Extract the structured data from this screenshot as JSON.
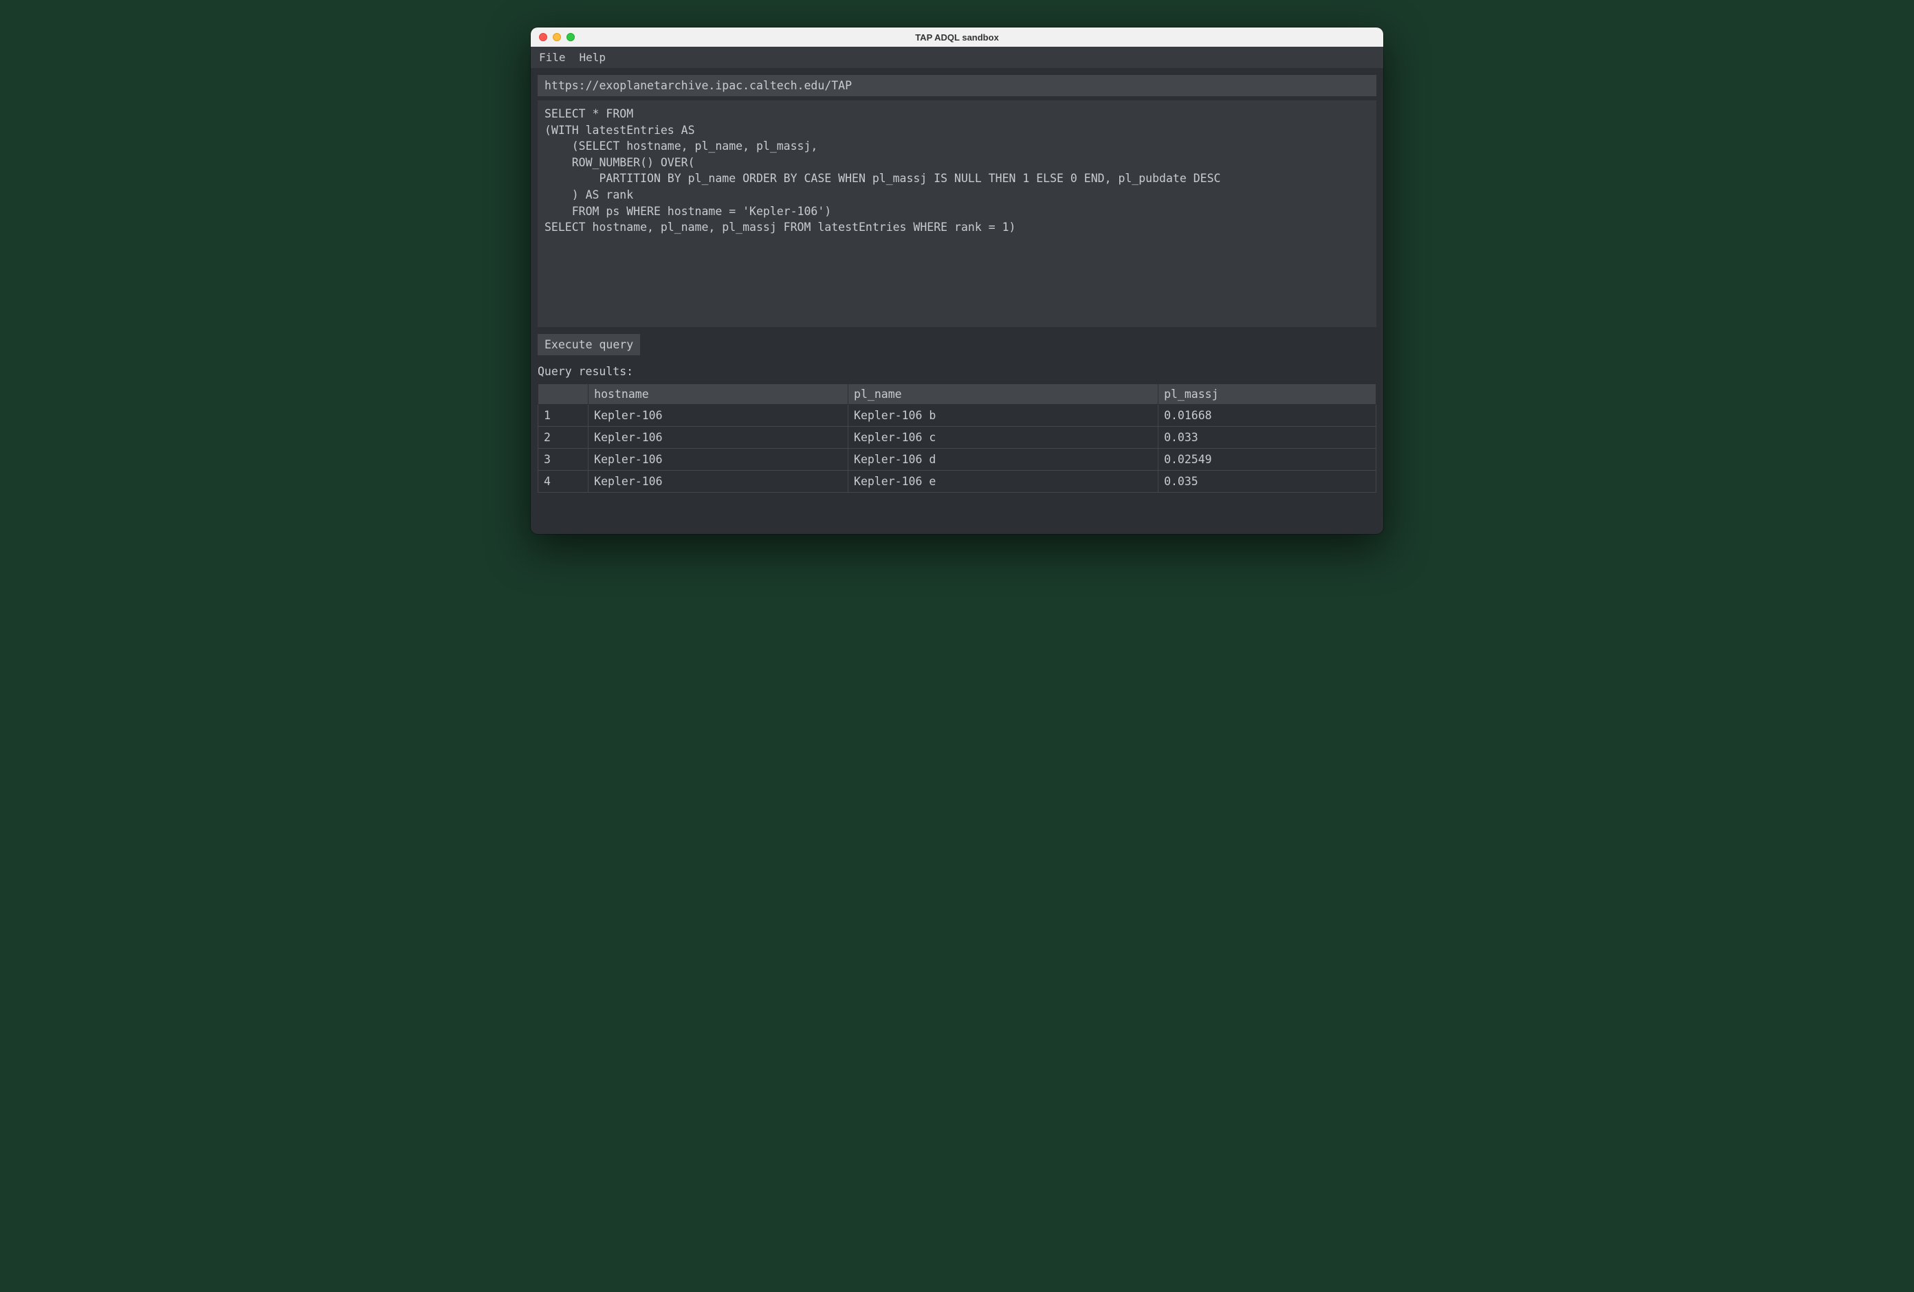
{
  "window": {
    "title": "TAP ADQL sandbox"
  },
  "menu": {
    "file": "File",
    "help": "Help"
  },
  "url": {
    "value": "https://exoplanetarchive.ipac.caltech.edu/TAP"
  },
  "query": {
    "text": "SELECT * FROM\n(WITH latestEntries AS\n    (SELECT hostname, pl_name, pl_massj,\n    ROW_NUMBER() OVER(\n        PARTITION BY pl_name ORDER BY CASE WHEN pl_massj IS NULL THEN 1 ELSE 0 END, pl_pubdate DESC\n    ) AS rank\n    FROM ps WHERE hostname = 'Kepler-106')\nSELECT hostname, pl_name, pl_massj FROM latestEntries WHERE rank = 1)"
  },
  "buttons": {
    "execute": "Execute query"
  },
  "results": {
    "label": "Query results:",
    "columns": [
      "hostname",
      "pl_name",
      "pl_massj"
    ],
    "rows": [
      {
        "idx": "1",
        "hostname": "Kepler-106",
        "pl_name": "Kepler-106 b",
        "pl_massj": "0.01668"
      },
      {
        "idx": "2",
        "hostname": "Kepler-106",
        "pl_name": "Kepler-106 c",
        "pl_massj": "0.033"
      },
      {
        "idx": "3",
        "hostname": "Kepler-106",
        "pl_name": "Kepler-106 d",
        "pl_massj": "0.02549"
      },
      {
        "idx": "4",
        "hostname": "Kepler-106",
        "pl_name": "Kepler-106 e",
        "pl_massj": "0.035"
      }
    ]
  }
}
